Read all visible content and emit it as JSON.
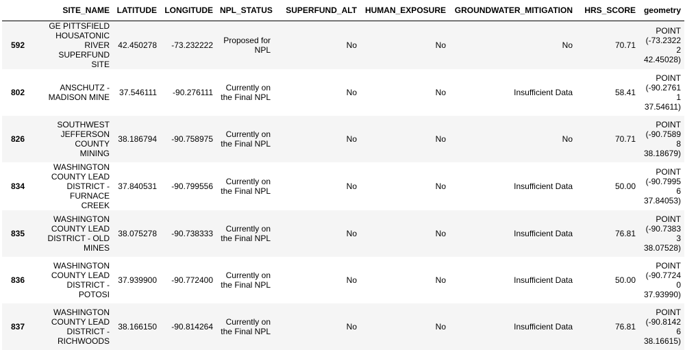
{
  "table": {
    "columns": [
      "",
      "SITE_NAME",
      "LATITUDE",
      "LONGITUDE",
      "NPL_STATUS",
      "SUPERFUND_ALT",
      "HUMAN_EXPOSURE",
      "GROUNDWATER_MITIGATION",
      "HRS_SCORE",
      "geometry"
    ],
    "rows": [
      {
        "index": "592",
        "site_name": "GE PITTSFIELD HOUSATONIC RIVER SUPERFUND SITE",
        "latitude": "42.450278",
        "longitude": "-73.232222",
        "npl_status": "Proposed for NPL",
        "superfund_alt": "No",
        "human_exposure": "No",
        "groundwater_mitigation": "No",
        "hrs_score": "70.71",
        "geometry": "POINT (-73.23222 42.45028)"
      },
      {
        "index": "802",
        "site_name": "ANSCHUTZ - MADISON MINE",
        "latitude": "37.546111",
        "longitude": "-90.276111",
        "npl_status": "Currently on the Final NPL",
        "superfund_alt": "No",
        "human_exposure": "No",
        "groundwater_mitigation": "Insufficient Data",
        "hrs_score": "58.41",
        "geometry": "POINT (-90.27611 37.54611)"
      },
      {
        "index": "826",
        "site_name": "SOUTHWEST JEFFERSON COUNTY MINING",
        "latitude": "38.186794",
        "longitude": "-90.758975",
        "npl_status": "Currently on the Final NPL",
        "superfund_alt": "No",
        "human_exposure": "No",
        "groundwater_mitigation": "No",
        "hrs_score": "70.71",
        "geometry": "POINT (-90.75898 38.18679)"
      },
      {
        "index": "834",
        "site_name": "WASHINGTON COUNTY LEAD DISTRICT - FURNACE CREEK",
        "latitude": "37.840531",
        "longitude": "-90.799556",
        "npl_status": "Currently on the Final NPL",
        "superfund_alt": "No",
        "human_exposure": "No",
        "groundwater_mitigation": "Insufficient Data",
        "hrs_score": "50.00",
        "geometry": "POINT (-90.79956 37.84053)"
      },
      {
        "index": "835",
        "site_name": "WASHINGTON COUNTY LEAD DISTRICT - OLD MINES",
        "latitude": "38.075278",
        "longitude": "-90.738333",
        "npl_status": "Currently on the Final NPL",
        "superfund_alt": "No",
        "human_exposure": "No",
        "groundwater_mitigation": "Insufficient Data",
        "hrs_score": "76.81",
        "geometry": "POINT (-90.73833 38.07528)"
      },
      {
        "index": "836",
        "site_name": "WASHINGTON COUNTY LEAD DISTRICT - POTOSI",
        "latitude": "37.939900",
        "longitude": "-90.772400",
        "npl_status": "Currently on the Final NPL",
        "superfund_alt": "No",
        "human_exposure": "No",
        "groundwater_mitigation": "Insufficient Data",
        "hrs_score": "50.00",
        "geometry": "POINT (-90.77240 37.93990)"
      },
      {
        "index": "837",
        "site_name": "WASHINGTON COUNTY LEAD DISTRICT - RICHWOODS",
        "latitude": "38.166150",
        "longitude": "-90.814264",
        "npl_status": "Currently on the Final NPL",
        "superfund_alt": "No",
        "human_exposure": "No",
        "groundwater_mitigation": "Insufficient Data",
        "hrs_score": "76.81",
        "geometry": "POINT (-90.81426 38.16615)"
      }
    ]
  }
}
